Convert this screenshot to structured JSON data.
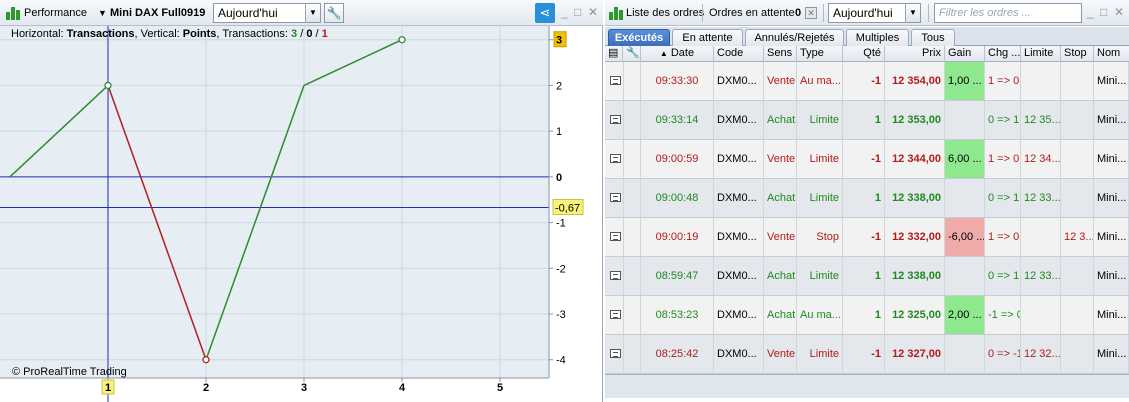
{
  "left_panel": {
    "title": "Performance",
    "instrument": "Mini DAX Full0919",
    "period": "Aujourd'hui",
    "info": {
      "horizontal_label": "Horizontal: ",
      "horizontal_value": "Transactions",
      "vertical_label": ", Vertical: ",
      "vertical_value": "Points",
      "transactions_label": ", Transactions: ",
      "t_green": "3",
      "t_slash1": " / ",
      "t_zero": "0",
      "t_slash2": " / ",
      "t_red": "1"
    },
    "copyright": "© ProRealTime Trading"
  },
  "chart_data": {
    "type": "line",
    "x": [
      0,
      1,
      2,
      3,
      4
    ],
    "y": [
      0,
      2,
      -4,
      2,
      3
    ],
    "segment_colors": [
      "#2e8b2e",
      "#b02020",
      "#2e8b2e",
      "#2e8b2e"
    ],
    "marker_colors": [
      "none",
      "#2e8b2e",
      "#b02020",
      "none",
      "#2e8b2e"
    ],
    "xlim": [
      0,
      5.5
    ],
    "ylim": [
      -4.4,
      3.3
    ],
    "x_ticks": [
      "1",
      "2",
      "3",
      "4",
      "5"
    ],
    "y_ticks": [
      "3",
      "2",
      "1",
      "0",
      "-1",
      "-2",
      "-3",
      "-4"
    ],
    "mean_line": -0.67,
    "mean_label": "-0,67",
    "cursor_x": 1,
    "cursor_x_label": "1",
    "last_value_label": "3"
  },
  "right_panel": {
    "title": "Liste des ordres",
    "pending_label": "Ordres en attente",
    "pending_count": "0",
    "period": "Aujourd'hui",
    "filter_placeholder": "Filtrer les ordres ...",
    "tabs": [
      "Exécutés",
      "En attente",
      "Annulés/Rejetés",
      "Multiples",
      "Tous"
    ],
    "columns": [
      "Date",
      "Code",
      "Sens",
      "Type",
      "Qté",
      "Prix",
      "Gain",
      "Chg ...",
      "Limite",
      "Stop",
      "Nom"
    ],
    "rows": [
      {
        "time": "09:33:30",
        "code": "DXM0...",
        "sens": "Vente",
        "type": "Au ma...",
        "qty": "-1",
        "prix": "12 354,00",
        "gain": "1,00 ...",
        "chg": "1 => 0",
        "limite": "",
        "stop": "",
        "nom": "Mini...",
        "side": "red",
        "gain_kind": "pos"
      },
      {
        "time": "09:33:14",
        "code": "DXM0...",
        "sens": "Achat",
        "type": "Limite",
        "qty": "1",
        "prix": "12 353,00",
        "gain": "",
        "chg": "0 => 1",
        "limite": "12 35...",
        "stop": "",
        "nom": "Mini...",
        "side": "green",
        "gain_kind": ""
      },
      {
        "time": "09:00:59",
        "code": "DXM0...",
        "sens": "Vente",
        "type": "Limite",
        "qty": "-1",
        "prix": "12 344,00",
        "gain": "6,00 ...",
        "chg": "1 => 0",
        "limite": "12 34...",
        "stop": "",
        "nom": "Mini...",
        "side": "red",
        "gain_kind": "pos"
      },
      {
        "time": "09:00:48",
        "code": "DXM0...",
        "sens": "Achat",
        "type": "Limite",
        "qty": "1",
        "prix": "12 338,00",
        "gain": "",
        "chg": "0 => 1",
        "limite": "12 33...",
        "stop": "",
        "nom": "Mini...",
        "side": "green",
        "gain_kind": ""
      },
      {
        "time": "09:00:19",
        "code": "DXM0...",
        "sens": "Vente",
        "type": "Stop",
        "qty": "-1",
        "prix": "12 332,00",
        "gain": "-6,00 ...",
        "chg": "1 => 0",
        "limite": "",
        "stop": "12 3...",
        "nom": "Mini...",
        "side": "red",
        "gain_kind": "neg"
      },
      {
        "time": "08:59:47",
        "code": "DXM0...",
        "sens": "Achat",
        "type": "Limite",
        "qty": "1",
        "prix": "12 338,00",
        "gain": "",
        "chg": "0 => 1",
        "limite": "12 33...",
        "stop": "",
        "nom": "Mini...",
        "side": "green",
        "gain_kind": ""
      },
      {
        "time": "08:53:23",
        "code": "DXM0...",
        "sens": "Achat",
        "type": "Au ma...",
        "qty": "1",
        "prix": "12 325,00",
        "gain": "2,00 ...",
        "chg": "-1 => 0",
        "limite": "",
        "stop": "",
        "nom": "Mini...",
        "side": "green",
        "gain_kind": "pos"
      },
      {
        "time": "08:25:42",
        "code": "DXM0...",
        "sens": "Vente",
        "type": "Limite",
        "qty": "-1",
        "prix": "12 327,00",
        "gain": "",
        "chg": "0 => -1",
        "limite": "12 32...",
        "stop": "",
        "nom": "Mini...",
        "side": "red",
        "gain_kind": ""
      }
    ]
  }
}
